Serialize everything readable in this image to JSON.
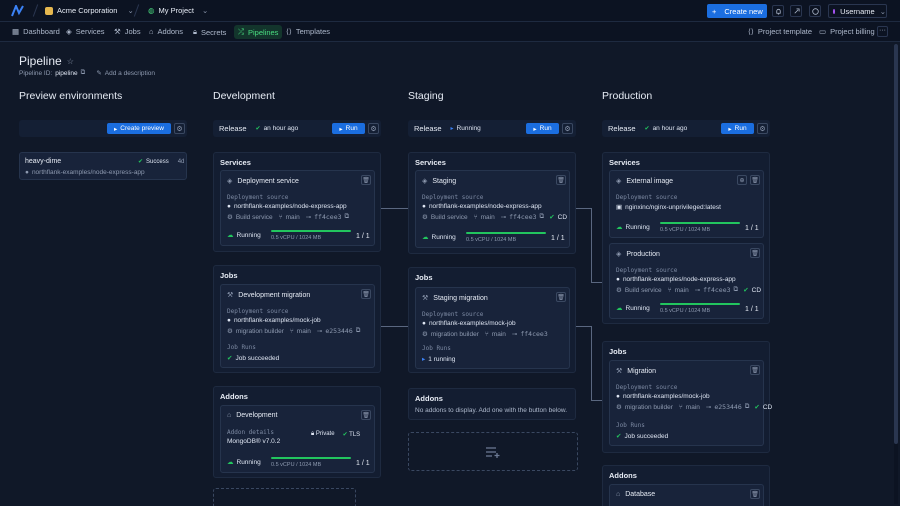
{
  "topbar": {
    "org": "Acme Corporation",
    "project": "My Project",
    "create_new": "Create new",
    "username": "Username"
  },
  "nav": {
    "dashboard": "Dashboard",
    "services": "Services",
    "jobs": "Jobs",
    "addons": "Addons",
    "secrets": "Secrets",
    "pipelines": "Pipelines",
    "templates": "Templates",
    "project_template": "Project template",
    "project_billing": "Project billing"
  },
  "header": {
    "title": "Pipeline",
    "id_label": "Pipeline ID:",
    "id_value": "pipeline",
    "add_desc": "Add a description"
  },
  "columns": {
    "preview": "Preview environments",
    "dev": "Development",
    "staging": "Staging",
    "prod": "Production"
  },
  "preview": {
    "create_button": "Create preview",
    "env_name": "heavy-dime",
    "status": "Success",
    "age": "4d",
    "repo": "northflank-examples/node-express-app"
  },
  "labels": {
    "release": "Release",
    "run": "Run",
    "services": "Services",
    "jobs": "Jobs",
    "addons": "Addons",
    "deploy_source": "Deployment source",
    "running": "Running",
    "resources": "0.5 vCPU / 1024 MB",
    "count": "1 / 1",
    "job_runs": "Job Runs",
    "job_succeeded": "Job succeeded",
    "addon_details": "Addon details",
    "private": "Private",
    "tls": "TLS",
    "cd": "CD"
  },
  "dev": {
    "release_status": "an hour ago",
    "service_name": "Deployment service",
    "service_repo": "northflank-examples/node-express-app",
    "build_service": "Build service",
    "branch": "main",
    "commit": "ff4cee3",
    "job_name": "Development migration",
    "job_repo": "northflank-examples/mock-job",
    "job_builder": "migration builder",
    "job_branch": "main",
    "job_commit": "e253446",
    "addon_name": "Development",
    "addon_version": "MongoDB® v7.0.2"
  },
  "staging": {
    "release_status": "Running",
    "service_name": "Staging",
    "service_repo": "northflank-examples/node-express-app",
    "build_service": "Build service",
    "branch": "main",
    "commit": "ff4cee3",
    "job_name": "Staging migration",
    "job_repo": "northflank-examples/mock-job",
    "job_builder": "migration builder",
    "job_branch": "main",
    "job_commit": "ff4cee3",
    "job_running": "1 running",
    "no_addons": "No addons to display. Add one with the button below."
  },
  "prod": {
    "release_status": "an hour ago",
    "ext_name": "External image",
    "ext_image": "nginxinc/nginx-unprivileged:latest",
    "service_name": "Production",
    "service_repo": "northflank-examples/node-express-app",
    "build_service": "Build service",
    "branch": "main",
    "commit": "ff4cee3",
    "job_name": "Migration",
    "job_repo": "northflank-examples/mock-job",
    "job_builder": "migration builder",
    "job_branch": "main",
    "job_commit": "e253446",
    "addon_name": "Database"
  },
  "colors": {
    "accent": "#1b6ee0",
    "success": "#22c55e",
    "bg": "#101828"
  }
}
